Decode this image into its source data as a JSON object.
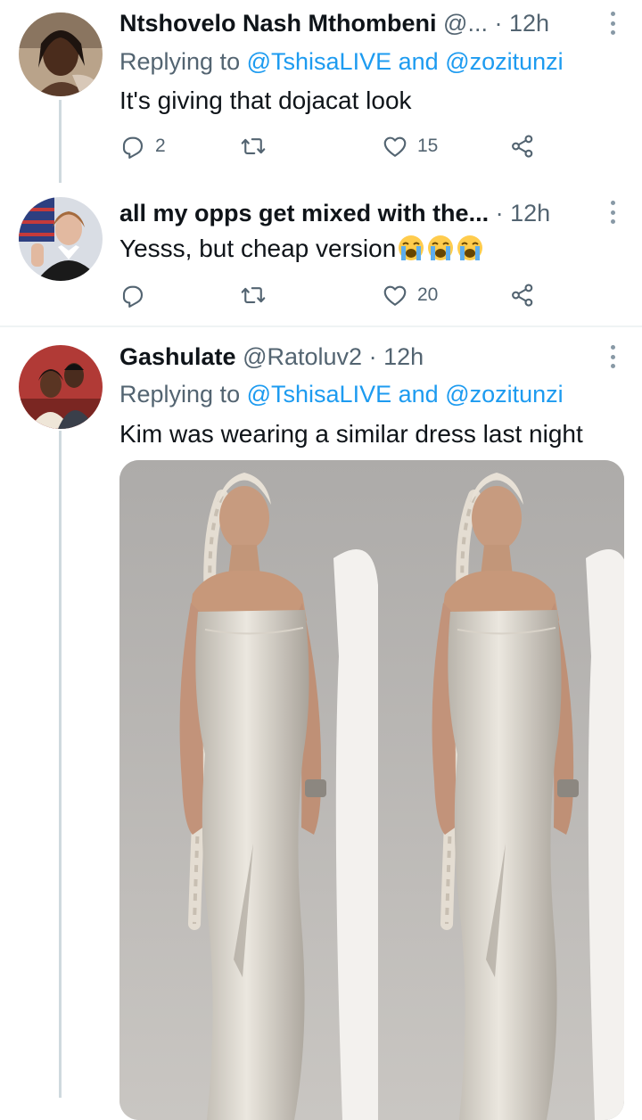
{
  "tweets": [
    {
      "name": "Ntshovelo Nash Mthombeni",
      "handle": "@...",
      "separator": "·",
      "time": "12h",
      "replying_prefix": "Replying to",
      "mention1": "@TshisaLIVE",
      "and": "and",
      "mention2": "@zozitunzi",
      "text": "It's giving that dojacat look",
      "replies": "2",
      "retweets": "",
      "likes": "15"
    },
    {
      "name": "all my opps get mixed with the...",
      "separator": "·",
      "time": "12h",
      "text": "Yesss, but cheap version",
      "emoji": "loudly-crying-face",
      "emoji_count": 3,
      "replies": "",
      "retweets": "",
      "likes": "20"
    },
    {
      "name": "Gashulate",
      "handle": "@Ratoluv2",
      "separator": "·",
      "time": "12h",
      "replying_prefix": "Replying to",
      "mention1": "@TshisaLIVE",
      "and": "and",
      "mention2": "@zozitunzi",
      "text": "Kim was wearing a similar dress last night"
    }
  ],
  "colors": {
    "link": "#1d9bf0",
    "secondary": "#536471",
    "thread_line": "#cfd9de",
    "divider": "#eff3f4"
  },
  "icons": [
    "reply-icon",
    "retweet-icon",
    "like-icon",
    "share-icon",
    "more-icon"
  ]
}
